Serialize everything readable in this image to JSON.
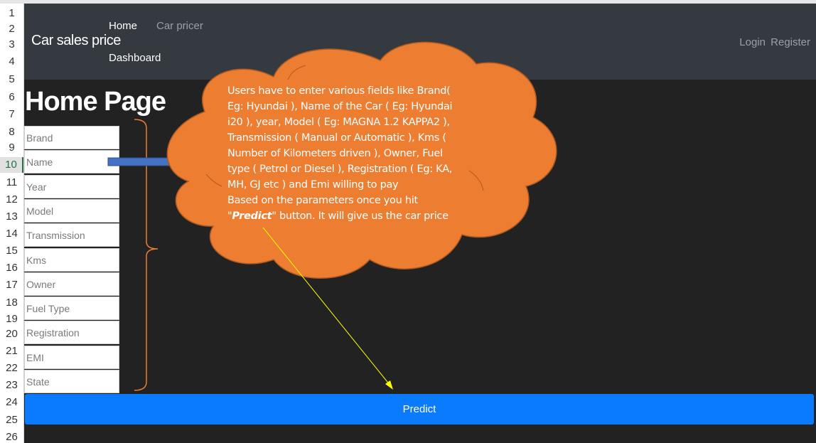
{
  "spreadsheet": {
    "row_numbers": [
      "1",
      "2",
      "3",
      "4",
      "5",
      "6",
      "7",
      "8",
      "9",
      "10",
      "11",
      "12",
      "13",
      "14",
      "15",
      "16",
      "17",
      "18",
      "19",
      "20",
      "21",
      "22",
      "23",
      "24",
      "25",
      "26"
    ],
    "active_row": "10"
  },
  "navbar": {
    "brand": "Car sales price",
    "links": {
      "home": "Home",
      "car_pricer": "Car pricer",
      "dashboard": "Dashboard",
      "login": "Login",
      "register": "Register"
    }
  },
  "page": {
    "title": "Home Page",
    "fields": [
      {
        "placeholder": "Brand"
      },
      {
        "placeholder": "Name"
      },
      {
        "placeholder": "Year"
      },
      {
        "placeholder": "Model"
      },
      {
        "placeholder": "Transmission"
      },
      {
        "placeholder": "Kms"
      },
      {
        "placeholder": "Owner"
      },
      {
        "placeholder": "Fuel Type"
      },
      {
        "placeholder": "Registration"
      },
      {
        "placeholder": "EMI"
      },
      {
        "placeholder": "State"
      }
    ],
    "predict_label": "Predict"
  },
  "annotation": {
    "lines": [
      "Users have to enter various fields like Brand(",
      "Eg: Hyundai ), Name of the Car ( Eg: Hyundai",
      "i20 ), year, Model ( Eg: MAGNA 1.2 KAPPA2 ),",
      "Transmission ( Manual or Automatic ), Kms (",
      "Number of Kilometers driven ), Owner, Fuel",
      "type ( Petrol or Diesel ), Registration ( Eg: KA,",
      "MH, GJ etc ) and Emi willing to pay",
      "Based on the parameters once you hit"
    ],
    "last_line_prefix": "\"",
    "last_line_emphasis": "Predict",
    "last_line_suffix": "\" button. It will give us the car price",
    "colors": {
      "callout_fill": "#ed7d31",
      "callout_stroke": "#ae5a21",
      "brace": "#ed7d31",
      "arrow_line": "#ffff00",
      "connector_fill": "#4472c4"
    }
  }
}
